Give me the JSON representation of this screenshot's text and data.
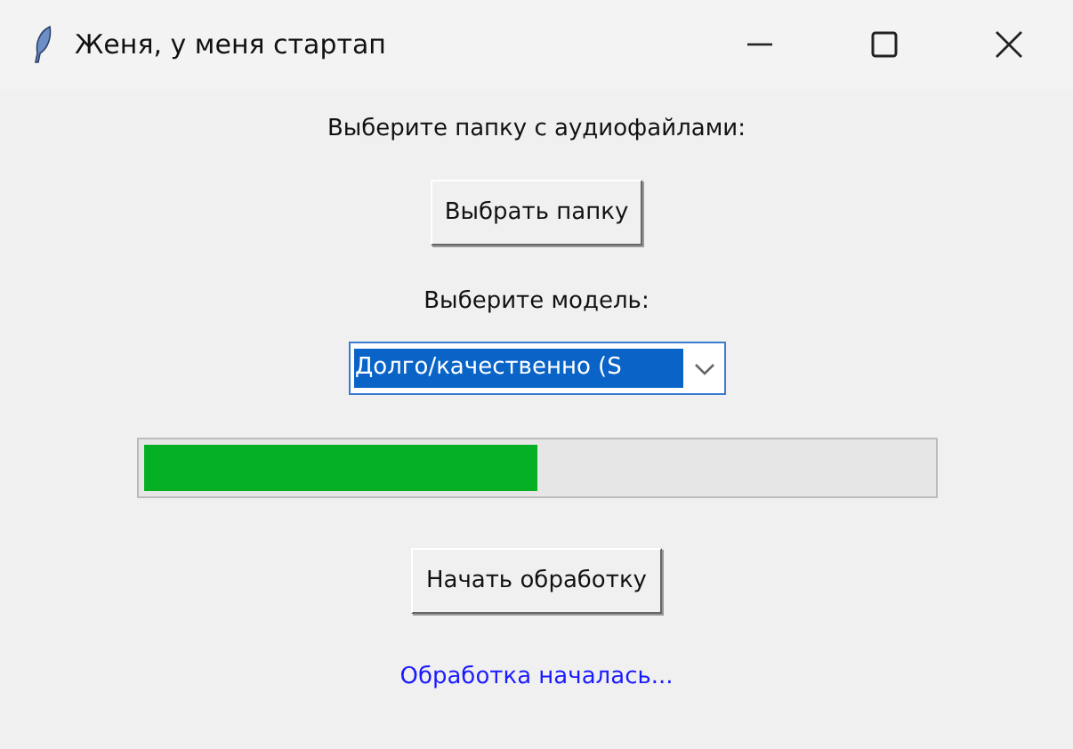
{
  "window": {
    "title": "Женя, у меня стартап"
  },
  "folder_prompt": "Выберите папку с аудиофайлами:",
  "folder_button": "Выбрать папку",
  "model_prompt": "Выберите модель:",
  "model_select": {
    "value": "Долго/качественно (S",
    "text_selected": true
  },
  "progress": {
    "level": 0.5
  },
  "start_button": "Начать обработку",
  "status": "Обработка началась..."
}
